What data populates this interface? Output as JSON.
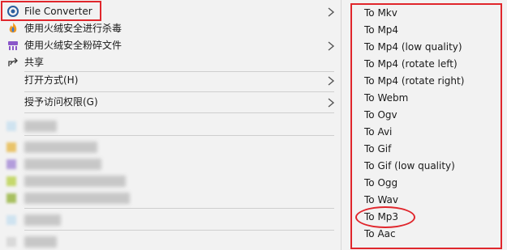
{
  "menu": {
    "items": [
      {
        "label": "File Converter",
        "icon": "file-converter-icon",
        "has_submenu": true
      },
      {
        "label": "使用火绒安全进行杀毒",
        "icon": "huorong-shield-icon",
        "has_submenu": false
      },
      {
        "label": "使用火绒安全粉碎文件",
        "icon": "huorong-shredder-icon",
        "has_submenu": true
      },
      {
        "label": "共享",
        "icon": "share-icon",
        "has_submenu": false
      },
      {
        "label": "打开方式(H)",
        "icon": "",
        "has_submenu": true
      },
      {
        "label": "授予访问权限(G)",
        "icon": "",
        "has_submenu": true
      }
    ]
  },
  "submenu": {
    "items": [
      "To Mkv",
      "To Mp4",
      "To Mp4 (low quality)",
      "To Mp4 (rotate left)",
      "To Mp4 (rotate right)",
      "To Webm",
      "To Ogv",
      "To Avi",
      "To Gif",
      "To Gif (low quality)",
      "To Ogg",
      "To Wav",
      "To Mp3",
      "To Aac"
    ],
    "highlighted": "To Mp3"
  },
  "colors": {
    "annotation": "#e0262c",
    "menu_bg": "#f2f2f2"
  }
}
